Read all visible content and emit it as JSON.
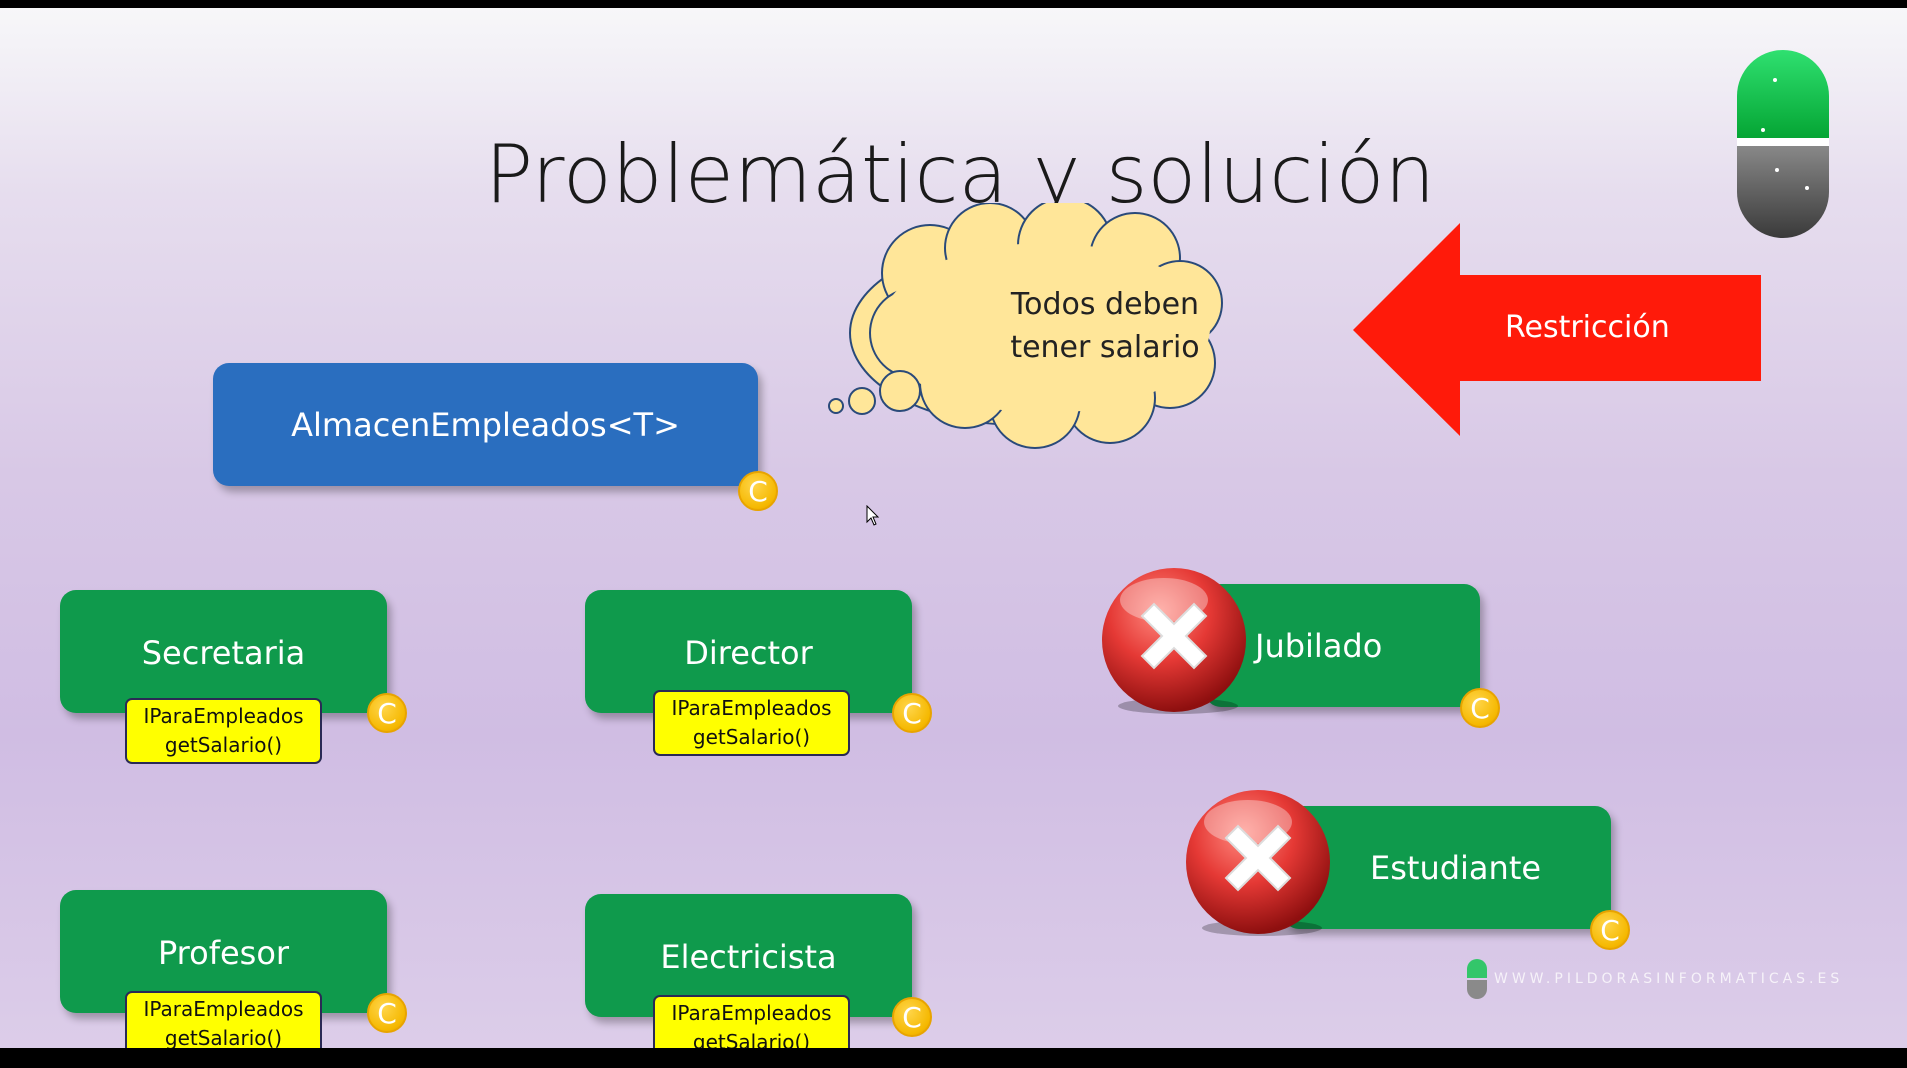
{
  "title": "Problemática y solución",
  "generic_class": "AlmacenEmpleados<T>",
  "restriction_label": "Restricción",
  "thought": {
    "line1": "Todos deben",
    "line2": "tener salario"
  },
  "class_badge": "C",
  "interface": {
    "name": "IParaEmpleados",
    "method": "getSalario()"
  },
  "valid_classes": [
    {
      "name": "Secretaria"
    },
    {
      "name": "Director"
    },
    {
      "name": "Profesor"
    },
    {
      "name": "Electricista"
    }
  ],
  "rejected_classes": [
    {
      "name": "Jubilado"
    },
    {
      "name": "Estudiante"
    }
  ],
  "footer_url": "WWW.PILDORASINFORMATICAS.ES",
  "colors": {
    "generic_box": "#2a6ebf",
    "class_box": "#0f9a4c",
    "interface_box": "#ffff00",
    "badge": "#f5b800",
    "arrow": "#ff1a0a",
    "cloud": "#ffe699",
    "reject": "#d81e1e"
  }
}
